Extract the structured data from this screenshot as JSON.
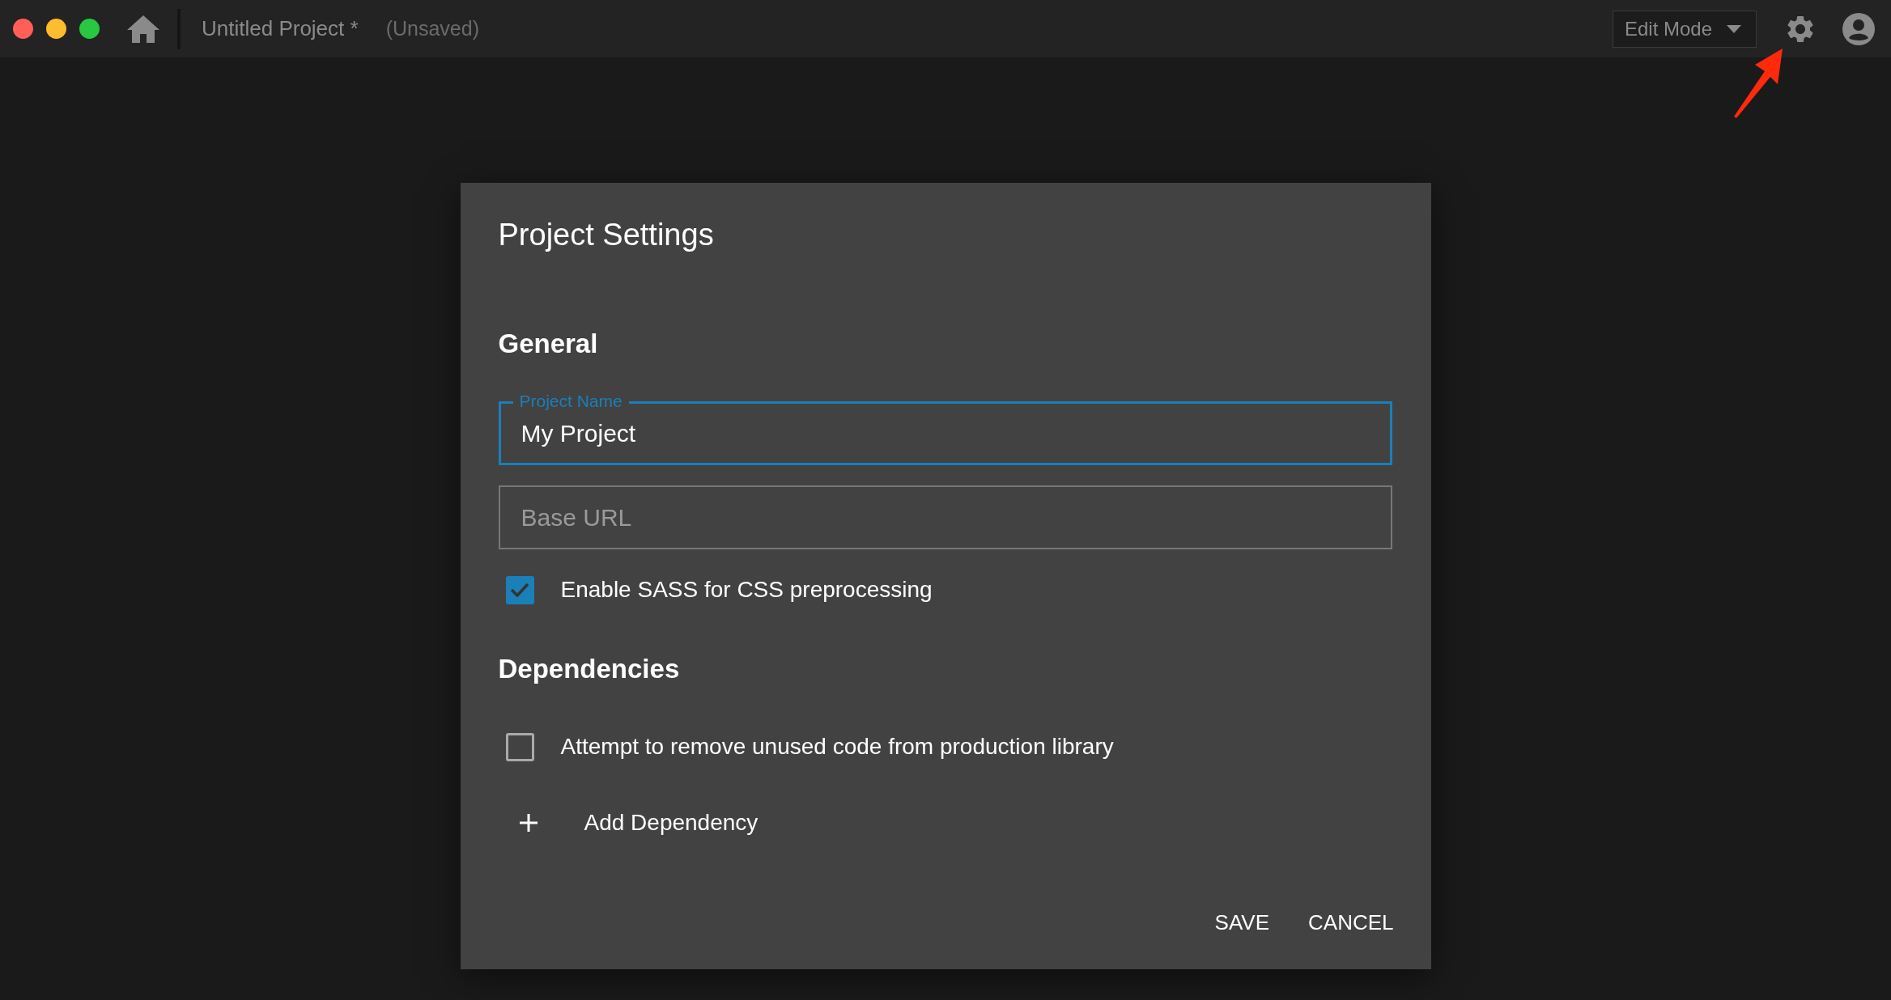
{
  "window": {
    "controls": [
      {
        "color": "#ff5f57"
      },
      {
        "color": "#febc2e"
      },
      {
        "color": "#28c840"
      }
    ]
  },
  "toolbar": {
    "title": "Untitled Project *",
    "status": "(Unsaved)",
    "mode_dropdown": "Edit Mode"
  },
  "dialog": {
    "title": "Project Settings",
    "sections": [
      {
        "heading": "General",
        "items": [
          {
            "kind": "text-field",
            "label": "Project Name",
            "value": "My Project",
            "focused": true
          },
          {
            "kind": "text-field",
            "placeholder": "Base URL",
            "focused": false
          },
          {
            "kind": "checkbox",
            "label": "Enable SASS for CSS preprocessing",
            "checked": true
          }
        ]
      },
      {
        "heading": "Dependencies",
        "items": [
          {
            "kind": "checkbox",
            "label": "Attempt to remove unused code from production library",
            "checked": false
          },
          {
            "kind": "add-button",
            "label": "Add Dependency"
          }
        ]
      }
    ],
    "actions": [
      "SAVE",
      "CANCEL"
    ]
  }
}
